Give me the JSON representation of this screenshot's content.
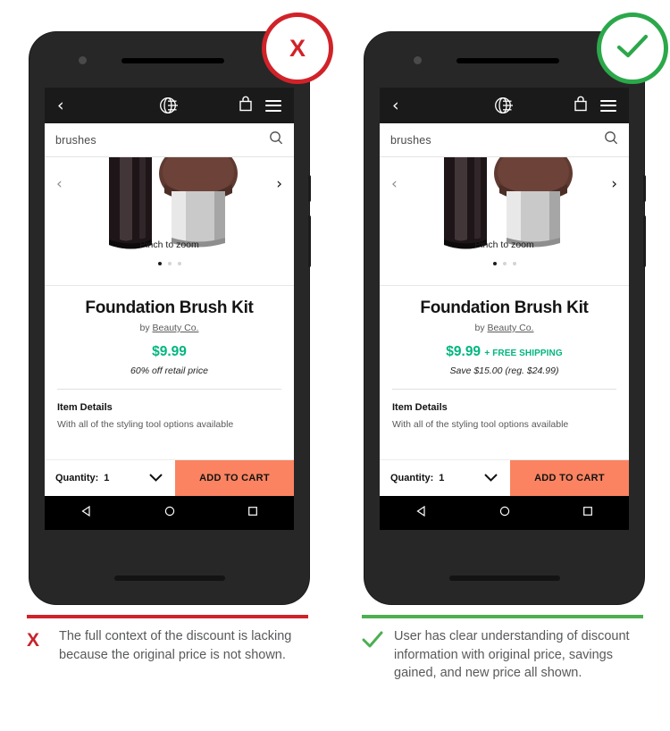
{
  "panels": [
    {
      "id": "left",
      "variant": "fail",
      "badge": {
        "icon": "x-mark-icon",
        "label": "X",
        "color": "#d12229"
      },
      "rule_color": "#d12229",
      "caption": {
        "mark_icon": "x-mark-icon",
        "mark_label": "X",
        "text": "The full context of the discount is lacking because the original price is not shown."
      },
      "screen": {
        "nav": {
          "back_icon": "chevron-left-icon",
          "back_label": "‹",
          "logo_icon": "globe-logo-icon",
          "bag_icon": "shopping-bag-icon",
          "menu_icon": "hamburger-menu-icon"
        },
        "search": {
          "value": "brushes",
          "placeholder": "Search",
          "icon": "search-icon"
        },
        "gallery": {
          "prev_icon": "chevron-left-icon",
          "prev_label": "‹",
          "next_icon": "chevron-right-icon",
          "next_label": "›",
          "hint": "Pinch to zoom",
          "dots": 3,
          "active_dot": 0
        },
        "product": {
          "title": "Foundation Brush Kit",
          "brand_prefix": "by ",
          "brand": "Beauty Co.",
          "price": "$9.99",
          "shipping_note": "",
          "subtext": "60% off retail price",
          "price_color": "#00b67f"
        },
        "details": {
          "heading": "Item Details",
          "body": "With all of the styling tool options available"
        },
        "action_bar": {
          "quantity_label": "Quantity:",
          "quantity_value": "1",
          "chevron_icon": "chevron-down-icon",
          "cart_label": "ADD TO CART",
          "cart_color": "#fb8361"
        },
        "android": {
          "back_icon": "android-back-icon",
          "home_icon": "android-home-icon",
          "recents_icon": "android-recents-icon"
        }
      }
    },
    {
      "id": "right",
      "variant": "success",
      "badge": {
        "icon": "check-mark-icon",
        "label": "✓",
        "color": "#2ba84a"
      },
      "rule_color": "#4caf50",
      "caption": {
        "mark_icon": "check-mark-icon",
        "mark_label": "✓",
        "text": "User has clear understanding of discount information with original price, savings gained, and new price all shown."
      },
      "screen": {
        "nav": {
          "back_icon": "chevron-left-icon",
          "back_label": "‹",
          "logo_icon": "globe-logo-icon",
          "bag_icon": "shopping-bag-icon",
          "menu_icon": "hamburger-menu-icon"
        },
        "search": {
          "value": "brushes",
          "placeholder": "Search",
          "icon": "search-icon"
        },
        "gallery": {
          "prev_icon": "chevron-left-icon",
          "prev_label": "‹",
          "next_icon": "chevron-right-icon",
          "next_label": "›",
          "hint": "Pinch to zoom",
          "dots": 3,
          "active_dot": 0
        },
        "product": {
          "title": "Foundation Brush Kit",
          "brand_prefix": "by ",
          "brand": "Beauty Co.",
          "price": "$9.99",
          "shipping_note": "+ FREE SHIPPING",
          "subtext": "Save $15.00 (reg. $24.99)",
          "price_color": "#00b67f"
        },
        "details": {
          "heading": "Item Details",
          "body": "With all of the styling tool options available"
        },
        "action_bar": {
          "quantity_label": "Quantity:",
          "quantity_value": "1",
          "chevron_icon": "chevron-down-icon",
          "cart_label": "ADD TO CART",
          "cart_color": "#fb8361"
        },
        "android": {
          "back_icon": "android-back-icon",
          "home_icon": "android-home-icon",
          "recents_icon": "android-recents-icon"
        }
      }
    }
  ]
}
